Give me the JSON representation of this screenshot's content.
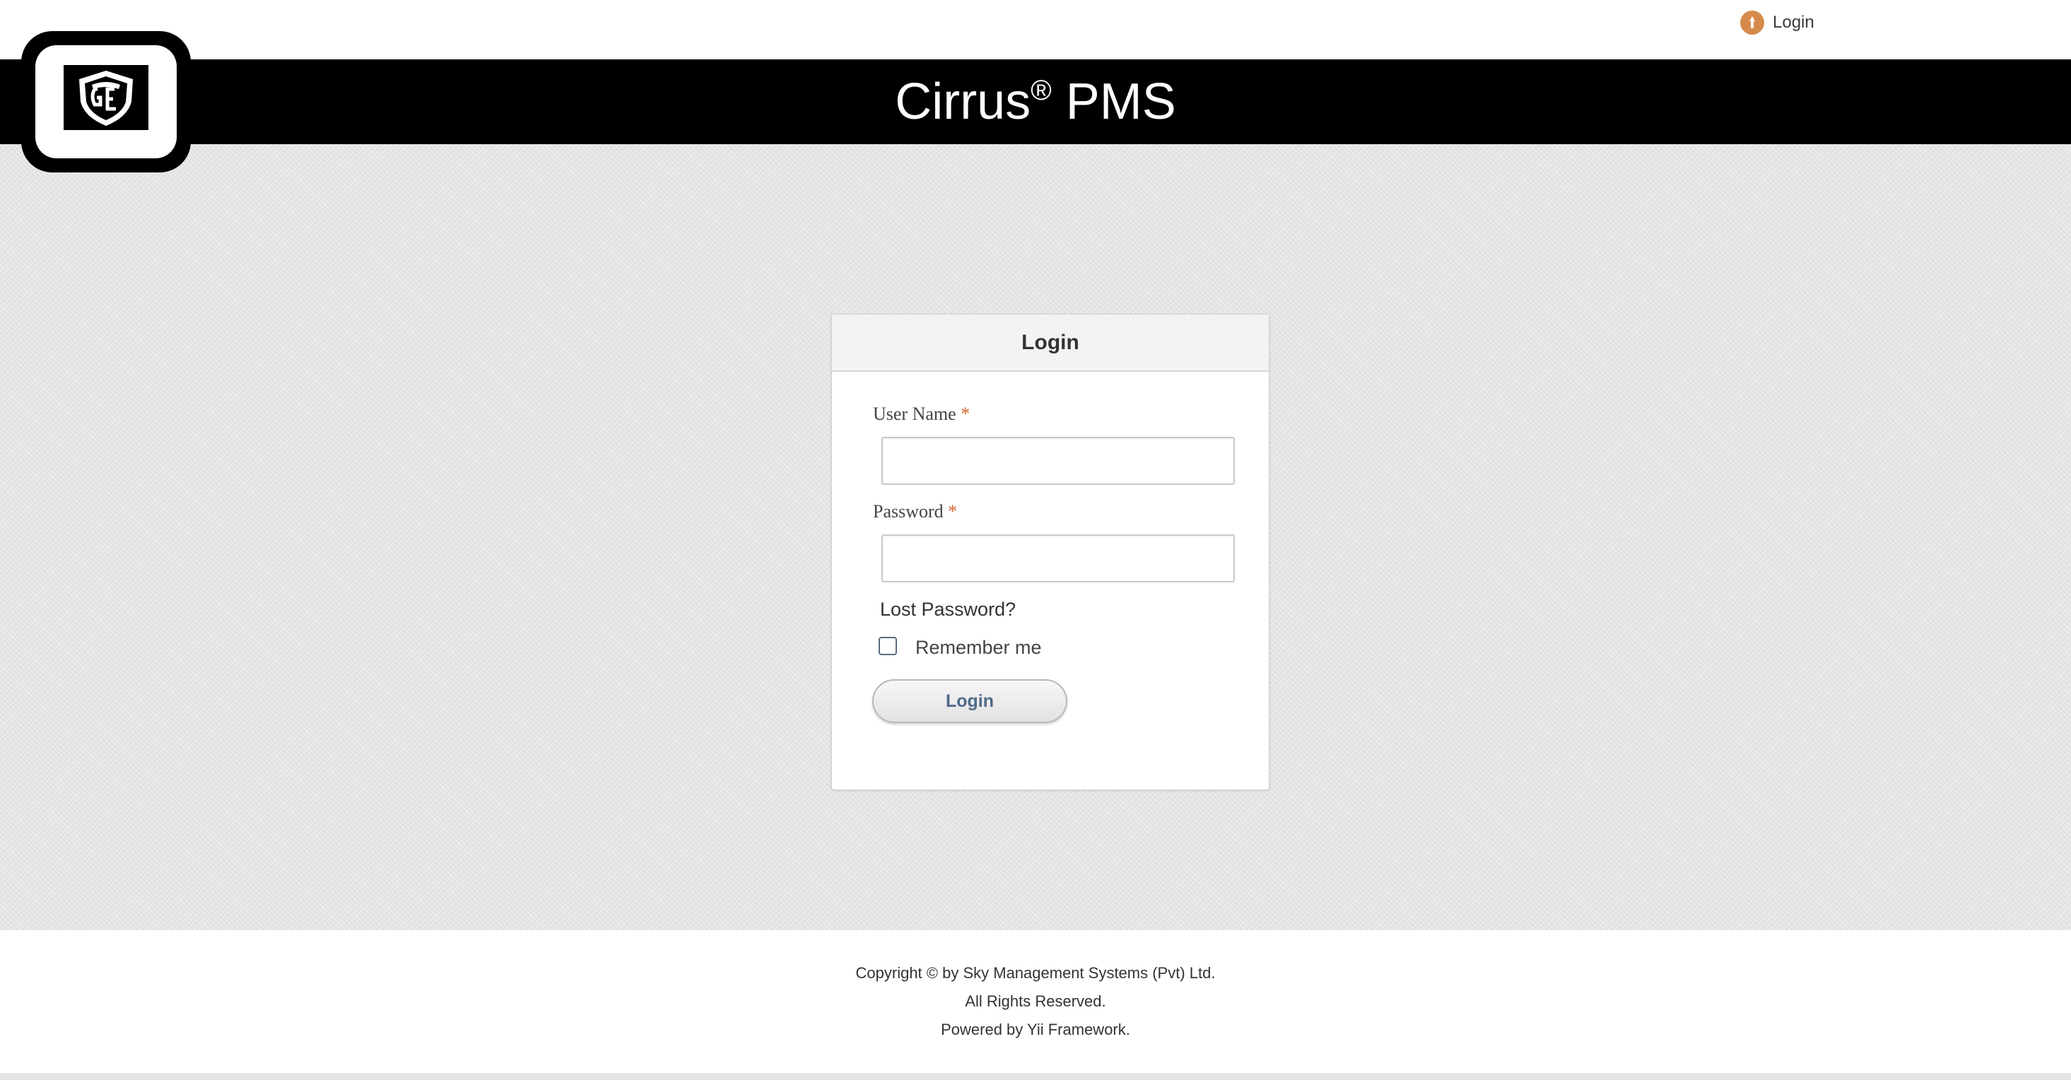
{
  "topbar": {
    "login_label": "Login",
    "login_icon": "key-badge-icon"
  },
  "header": {
    "title": "Cirrus",
    "registered": "®",
    "title_suffix": " PMS"
  },
  "logo": {
    "name": "shield-logo-icon"
  },
  "login_panel": {
    "heading": "Login",
    "username_label": "User Name",
    "password_label": "Password",
    "required_mark": "*",
    "lost_password": "Lost Password?",
    "remember_me": "Remember me",
    "submit_label": "Login",
    "username_value": "",
    "password_value": ""
  },
  "footer": {
    "line1": "Copyright © by Sky Management Systems (Pvt) Ltd.",
    "line2": "All Rights Reserved.",
    "line3": "Powered by Yii Framework."
  },
  "colors": {
    "header_bg": "#000000",
    "accent_orange": "#d58a4a",
    "required": "#d2642a",
    "button_text": "#4d6a88"
  }
}
